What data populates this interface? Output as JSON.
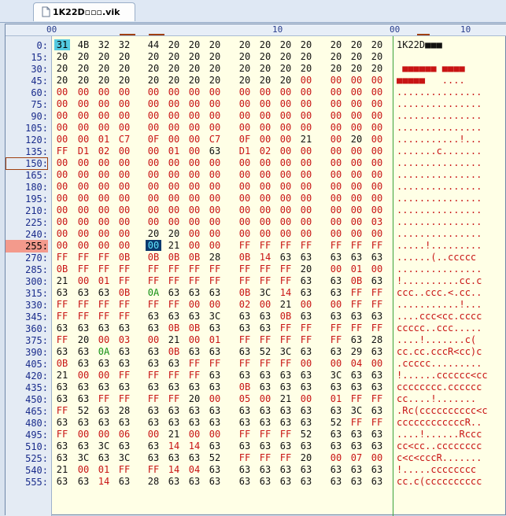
{
  "tab": {
    "label": "1K22D▫▫▫.vik"
  },
  "ruler": {
    "hex_labels": [
      "00",
      "10"
    ],
    "ascii_labels": [
      "00",
      "10"
    ]
  },
  "offsets": [
    "0:",
    "15:",
    "30:",
    "45:",
    "60:",
    "75:",
    "90:",
    "105:",
    "120:",
    "135:",
    "150:",
    "165:",
    "180:",
    "195:",
    "210:",
    "225:",
    "240:",
    "255:",
    "270:",
    "285:",
    "300:",
    "315:",
    "330:",
    "345:",
    "360:",
    "375:",
    "390:",
    "405:",
    "420:",
    "435:",
    "450:",
    "465:",
    "480:",
    "495:",
    "510:",
    "525:",
    "540:",
    "555:"
  ],
  "highlight_offset_index": 17,
  "boxed_offset_index": 10,
  "hex_rows": [
    [
      "31",
      "4B",
      "32",
      "32",
      "44",
      "20",
      "20",
      "20",
      "20",
      "20",
      "20",
      "20",
      "20",
      "20",
      "20"
    ],
    [
      "20",
      "20",
      "20",
      "20",
      "20",
      "20",
      "20",
      "20",
      "20",
      "20",
      "20",
      "20",
      "20",
      "20",
      "20"
    ],
    [
      "20",
      "20",
      "20",
      "20",
      "20",
      "20",
      "20",
      "20",
      "20",
      "20",
      "20",
      "20",
      "20",
      "20",
      "20"
    ],
    [
      "20",
      "20",
      "20",
      "20",
      "20",
      "20",
      "20",
      "20",
      "20",
      "20",
      "20",
      "00",
      "00",
      "00",
      "00"
    ],
    [
      "00",
      "00",
      "00",
      "00",
      "00",
      "00",
      "00",
      "00",
      "00",
      "00",
      "00",
      "00",
      "00",
      "00",
      "00"
    ],
    [
      "00",
      "00",
      "00",
      "00",
      "00",
      "00",
      "00",
      "00",
      "00",
      "00",
      "00",
      "00",
      "00",
      "00",
      "00"
    ],
    [
      "00",
      "00",
      "00",
      "00",
      "00",
      "00",
      "00",
      "00",
      "00",
      "00",
      "00",
      "00",
      "00",
      "00",
      "00"
    ],
    [
      "00",
      "00",
      "00",
      "00",
      "00",
      "00",
      "00",
      "00",
      "00",
      "00",
      "00",
      "00",
      "00",
      "00",
      "00"
    ],
    [
      "00",
      "00",
      "01",
      "C7",
      "0F",
      "00",
      "00",
      "C7",
      "0F",
      "00",
      "00",
      "21",
      "00",
      "20",
      "00"
    ],
    [
      "FF",
      "D1",
      "02",
      "00",
      "00",
      "01",
      "00",
      "63",
      "D1",
      "02",
      "00",
      "00",
      "00",
      "00",
      "00"
    ],
    [
      "00",
      "00",
      "00",
      "00",
      "00",
      "00",
      "00",
      "00",
      "00",
      "00",
      "00",
      "00",
      "00",
      "00",
      "00"
    ],
    [
      "00",
      "00",
      "00",
      "00",
      "00",
      "00",
      "00",
      "00",
      "00",
      "00",
      "00",
      "00",
      "00",
      "00",
      "00"
    ],
    [
      "00",
      "00",
      "00",
      "00",
      "00",
      "00",
      "00",
      "00",
      "00",
      "00",
      "00",
      "00",
      "00",
      "00",
      "00"
    ],
    [
      "00",
      "00",
      "00",
      "00",
      "00",
      "00",
      "00",
      "00",
      "00",
      "00",
      "00",
      "00",
      "00",
      "00",
      "00"
    ],
    [
      "00",
      "00",
      "00",
      "00",
      "00",
      "00",
      "00",
      "00",
      "00",
      "00",
      "00",
      "00",
      "00",
      "00",
      "00"
    ],
    [
      "00",
      "00",
      "00",
      "00",
      "00",
      "00",
      "00",
      "00",
      "00",
      "00",
      "00",
      "00",
      "00",
      "00",
      "03"
    ],
    [
      "00",
      "00",
      "00",
      "00",
      "20",
      "20",
      "00",
      "00",
      "00",
      "00",
      "00",
      "00",
      "00",
      "00",
      "00"
    ],
    [
      "00",
      "00",
      "00",
      "00",
      "00",
      "21",
      "00",
      "00",
      "FF",
      "FF",
      "FF",
      "FF",
      "FF",
      "FF",
      "FF"
    ],
    [
      "FF",
      "FF",
      "FF",
      "0B",
      "0B",
      "0B",
      "0B",
      "28",
      "0B",
      "14",
      "63",
      "63",
      "63",
      "63",
      "63"
    ],
    [
      "0B",
      "FF",
      "FF",
      "FF",
      "FF",
      "FF",
      "FF",
      "FF",
      "FF",
      "FF",
      "FF",
      "20",
      "00",
      "01",
      "00"
    ],
    [
      "21",
      "00",
      "01",
      "FF",
      "FF",
      "FF",
      "FF",
      "FF",
      "FF",
      "FF",
      "FF",
      "63",
      "63",
      "0B",
      "63"
    ],
    [
      "63",
      "63",
      "63",
      "0B",
      "0A",
      "63",
      "63",
      "63",
      "0B",
      "3C",
      "14",
      "63",
      "63",
      "FF",
      "FF"
    ],
    [
      "FF",
      "FF",
      "FF",
      "FF",
      "FF",
      "FF",
      "00",
      "00",
      "02",
      "00",
      "21",
      "00",
      "00",
      "FF",
      "FF"
    ],
    [
      "FF",
      "FF",
      "FF",
      "FF",
      "63",
      "63",
      "63",
      "3C",
      "63",
      "63",
      "0B",
      "63",
      "63",
      "63",
      "63"
    ],
    [
      "63",
      "63",
      "63",
      "63",
      "63",
      "0B",
      "0B",
      "63",
      "63",
      "63",
      "FF",
      "FF",
      "FF",
      "FF",
      "FF"
    ],
    [
      "FF",
      "20",
      "00",
      "03",
      "00",
      "21",
      "00",
      "01",
      "FF",
      "FF",
      "FF",
      "FF",
      "FF",
      "63",
      "28"
    ],
    [
      "63",
      "63",
      "0A",
      "63",
      "63",
      "0B",
      "63",
      "63",
      "63",
      "52",
      "3C",
      "63",
      "63",
      "29",
      "63"
    ],
    [
      "0B",
      "63",
      "63",
      "63",
      "63",
      "63",
      "FF",
      "FF",
      "FF",
      "FF",
      "FF",
      "00",
      "00",
      "04",
      "00"
    ],
    [
      "21",
      "00",
      "00",
      "FF",
      "FF",
      "FF",
      "FF",
      "63",
      "63",
      "63",
      "63",
      "63",
      "3C",
      "63",
      "63"
    ],
    [
      "63",
      "63",
      "63",
      "63",
      "63",
      "63",
      "63",
      "63",
      "0B",
      "63",
      "63",
      "63",
      "63",
      "63",
      "63"
    ],
    [
      "63",
      "63",
      "FF",
      "FF",
      "FF",
      "FF",
      "20",
      "00",
      "05",
      "00",
      "21",
      "00",
      "01",
      "FF",
      "FF"
    ],
    [
      "FF",
      "52",
      "63",
      "28",
      "63",
      "63",
      "63",
      "63",
      "63",
      "63",
      "63",
      "63",
      "63",
      "3C",
      "63"
    ],
    [
      "63",
      "63",
      "63",
      "63",
      "63",
      "63",
      "63",
      "63",
      "63",
      "63",
      "63",
      "63",
      "52",
      "FF",
      "FF"
    ],
    [
      "FF",
      "00",
      "00",
      "06",
      "00",
      "21",
      "00",
      "00",
      "FF",
      "FF",
      "FF",
      "52",
      "63",
      "63",
      "63"
    ],
    [
      "63",
      "63",
      "3C",
      "63",
      "63",
      "14",
      "14",
      "63",
      "63",
      "63",
      "63",
      "63",
      "63",
      "63",
      "63"
    ],
    [
      "63",
      "3C",
      "63",
      "3C",
      "63",
      "63",
      "63",
      "52",
      "FF",
      "FF",
      "FF",
      "20",
      "00",
      "07",
      "00"
    ],
    [
      "21",
      "00",
      "01",
      "FF",
      "FF",
      "14",
      "04",
      "63",
      "63",
      "63",
      "63",
      "63",
      "63",
      "63",
      "63"
    ],
    [
      "63",
      "63",
      "14",
      "63",
      "28",
      "63",
      "63",
      "63",
      "63",
      "63",
      "63",
      "63",
      "63",
      "63",
      "63"
    ]
  ],
  "ascii_rows": [
    "1K22D■■■",
    "",
    " ■■■■■■ ■■■■",
    "■■■■■   ....",
    "...............",
    "...............",
    "...............",
    "...............",
    "...........!...",
    ".......c.......",
    "...............",
    "...............",
    "...............",
    "...............",
    "...............",
    "...............",
    "...............",
    ".....!.........",
    "......(..ccccc",
    "...............",
    "!..........cc.c",
    "ccc..ccc.<.cc..",
    "...........!...",
    "....ccc<cc.cccc",
    "ccccc..ccc.....",
    "....!.......c(",
    "cc.cc.cccR<cc)c",
    ".ccccc.........",
    "!......cccccc<cc",
    "cccccccc.cccccc",
    "cc....!.......",
    ".Rc(cccccccccc<c",
    "ccccccccccccR..",
    "....!......Rccc",
    "cc<cc..cccccccc",
    "c<c<cccR.......",
    "!.....cccccccc",
    "cc.c(cccccccccc"
  ],
  "cursor": {
    "row": 17,
    "col": 4
  },
  "selection": {
    "row": 0,
    "col": 0
  }
}
